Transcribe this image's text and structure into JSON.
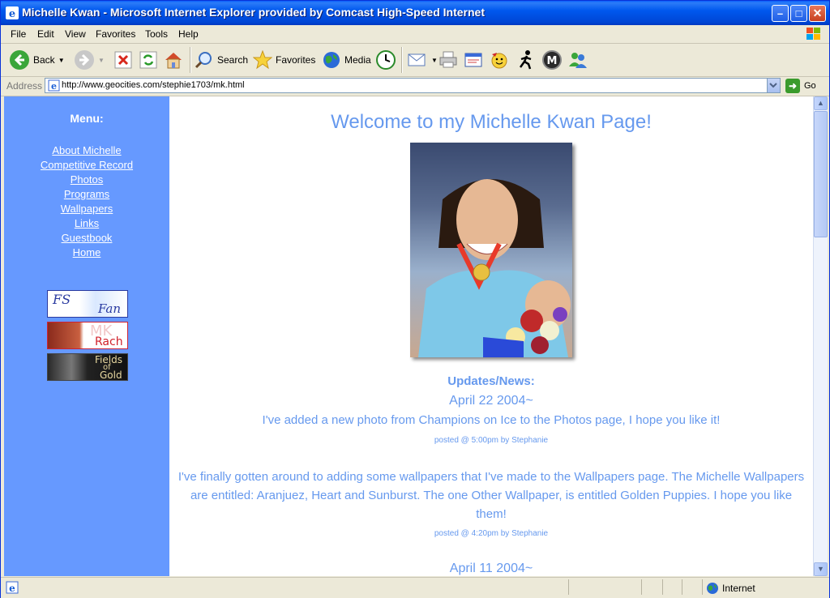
{
  "window": {
    "title": "Michelle Kwan - Microsoft Internet Explorer provided by Comcast High-Speed Internet",
    "min_symbol": "–",
    "max_symbol": "□",
    "close_symbol": "✕"
  },
  "menubar": {
    "items": [
      "File",
      "Edit",
      "View",
      "Favorites",
      "Tools",
      "Help"
    ]
  },
  "toolbar": {
    "back_label": "Back",
    "search_label": "Search",
    "favorites_label": "Favorites",
    "media_label": "Media"
  },
  "address": {
    "label": "Address",
    "url": "http://www.geocities.com/stephie1703/mk.html",
    "go_label": "Go"
  },
  "sidebar": {
    "menu_title": "Menu:",
    "links": [
      "About Michelle",
      "Competitive Record",
      "Photos",
      "Programs",
      "Wallpapers",
      "Links",
      "Guestbook",
      "Home"
    ],
    "banners": {
      "fsfan_a": "FS",
      "fsfan_b": "Fan",
      "mk_a": "MK",
      "mk_b": "Rach",
      "fields_a": "Fields",
      "fields_b": "of",
      "fields_c": "Gold"
    }
  },
  "main": {
    "welcome": "Welcome to my Michelle Kwan Page!",
    "updates_heading": "Updates/News:",
    "date1": "April 22 2004~",
    "post1": "I've added a new photo from Champions on Ice to the Photos page, I hope you like it!",
    "posted1": "posted @ 5:00pm by Stephanie",
    "post2": "I've finally gotten around to adding some wallpapers that I've made to the Wallpapers page. The Michelle Wallpapers are entitled: Aranjuez, Heart and Sunburst. The one Other Wallpaper, is entitled Golden Puppies. I hope you like them!",
    "posted2": "posted @ 4:20pm by Stephanie",
    "date2": "April 11 2004~"
  },
  "status": {
    "zone": "Internet"
  },
  "colors": {
    "sidebar_bg": "#6699ff",
    "text_blue": "#6699ee"
  }
}
